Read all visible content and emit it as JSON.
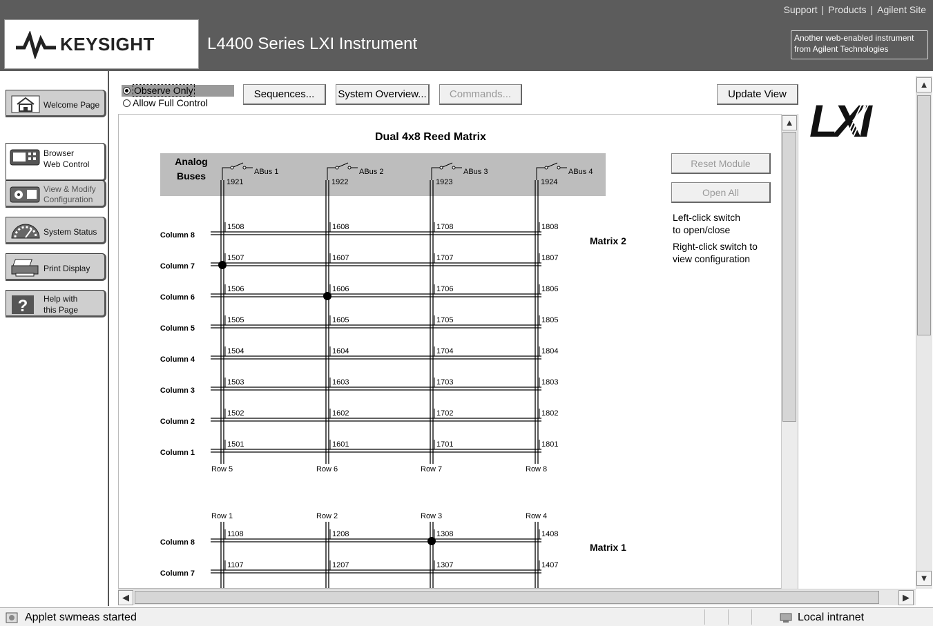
{
  "header": {
    "top_links": [
      "Support",
      "Products",
      "Agilent Site"
    ],
    "brand": "KEYSIGHT",
    "title": "L4400 Series LXI Instrument",
    "tagline_1": "Another web-enabled instrument",
    "tagline_2": "from Agilent Technologies"
  },
  "nav": [
    {
      "line1": "Welcome Page",
      "line2": "",
      "icon": "house-icon"
    },
    {
      "line1": "Browser",
      "line2": "Web Control",
      "icon": "web-control-icon"
    },
    {
      "line1": "View & Modify",
      "line2": "Configuration",
      "icon": "configuration-icon"
    },
    {
      "line1": "System Status",
      "line2": "",
      "icon": "gauge-icon"
    },
    {
      "line1": "Print Display",
      "line2": "",
      "icon": "printer-icon"
    },
    {
      "line1": "Help with",
      "line2": "this Page",
      "icon": "help-icon"
    }
  ],
  "controls": {
    "radio_observe": "Observe Only",
    "radio_full": "Allow Full Control",
    "selected_mode": "Observe Only",
    "sequences": "Sequences...",
    "system_overview": "System Overview...",
    "commands": "Commands...",
    "update_view": "Update View"
  },
  "matrix": {
    "title": "Dual 4x8 Reed Matrix",
    "analog_label_1": "Analog",
    "analog_label_2": "Buses",
    "abus": [
      {
        "name": "ABus 1",
        "relay": "1921"
      },
      {
        "name": "ABus 2",
        "relay": "1922"
      },
      {
        "name": "ABus 3",
        "relay": "1923"
      },
      {
        "name": "ABus 4",
        "relay": "1924"
      }
    ],
    "matrix2_label": "Matrix 2",
    "matrix1_label": "Matrix 1",
    "m2_rows": [
      "Row 5",
      "Row 6",
      "Row 7",
      "Row 8"
    ],
    "m1_rows": [
      "Row 1",
      "Row 2",
      "Row 3",
      "Row 4"
    ],
    "columns_m2": [
      {
        "label": "Column 8",
        "relays": [
          "1508",
          "1608",
          "1708",
          "1808"
        ]
      },
      {
        "label": "Column 7",
        "relays": [
          "1507",
          "1607",
          "1707",
          "1807"
        ]
      },
      {
        "label": "Column 6",
        "relays": [
          "1506",
          "1606",
          "1706",
          "1806"
        ]
      },
      {
        "label": "Column 5",
        "relays": [
          "1505",
          "1605",
          "1705",
          "1805"
        ]
      },
      {
        "label": "Column 4",
        "relays": [
          "1504",
          "1604",
          "1704",
          "1804"
        ]
      },
      {
        "label": "Column 3",
        "relays": [
          "1503",
          "1603",
          "1703",
          "1803"
        ]
      },
      {
        "label": "Column 2",
        "relays": [
          "1502",
          "1602",
          "1702",
          "1802"
        ]
      },
      {
        "label": "Column 1",
        "relays": [
          "1501",
          "1601",
          "1701",
          "1801"
        ]
      }
    ],
    "columns_m1": [
      {
        "label": "Column 8",
        "relays": [
          "1108",
          "1208",
          "1308",
          "1408"
        ]
      },
      {
        "label": "Column 7",
        "relays": [
          "1107",
          "1207",
          "1307",
          "1407"
        ]
      }
    ],
    "closed_relays": [
      "1507",
      "1606",
      "1308"
    ]
  },
  "side": {
    "reset_module": "Reset Module",
    "open_all": "Open All",
    "hint1_a": "Left-click switch",
    "hint1_b": "to open/close",
    "hint2_a": "Right-click switch to",
    "hint2_b": "view configuration"
  },
  "statusbar": {
    "message": "Applet swmeas started",
    "zone": "Local intranet"
  },
  "lxi_logo": "LXI"
}
